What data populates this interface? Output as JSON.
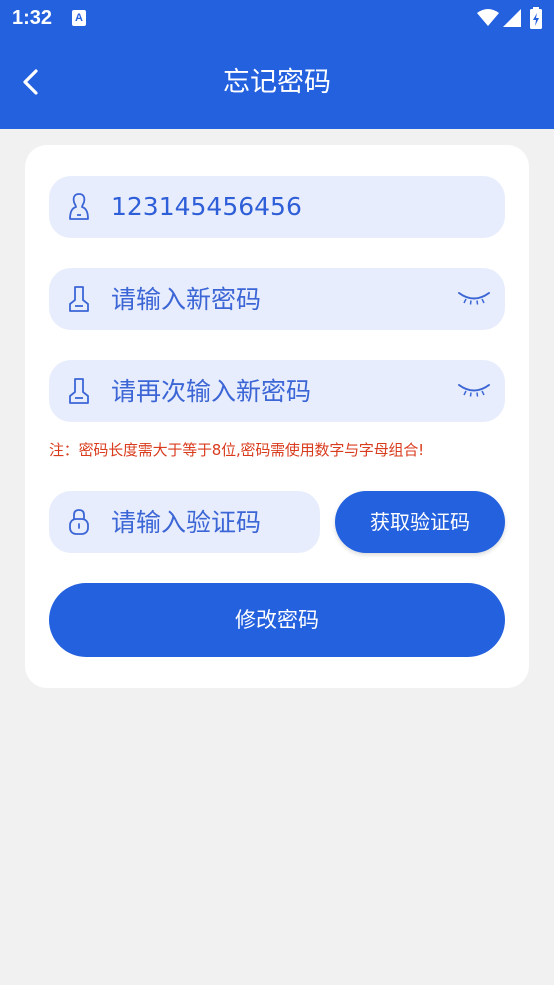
{
  "status_bar": {
    "time": "1:32",
    "notification_icon_letter": "A",
    "icons": [
      "wifi-icon",
      "signal-icon",
      "battery-icon"
    ]
  },
  "header": {
    "title": "忘记密码",
    "back_icon": "chevron-left-icon"
  },
  "form": {
    "phone": {
      "value": "123145456456",
      "icon": "user-icon"
    },
    "new_password": {
      "placeholder": "请输入新密码",
      "icon": "password-icon",
      "toggle_icon": "eye-closed-icon"
    },
    "confirm_password": {
      "placeholder": "请再次输入新密码",
      "icon": "password-icon",
      "toggle_icon": "eye-closed-icon"
    },
    "note": "注：密码长度需大于等于8位,密码需使用数字与字母组合!",
    "verification_code": {
      "placeholder": "请输入验证码",
      "icon": "lock-icon"
    },
    "get_code_label": "获取验证码",
    "submit_label": "修改密码"
  },
  "colors": {
    "primary": "#2461df",
    "field_bg": "#e7edfc",
    "field_text": "#2f5fd8",
    "note_text": "#d93b1d",
    "page_bg": "#f1f1f1",
    "card_bg": "#ffffff"
  }
}
